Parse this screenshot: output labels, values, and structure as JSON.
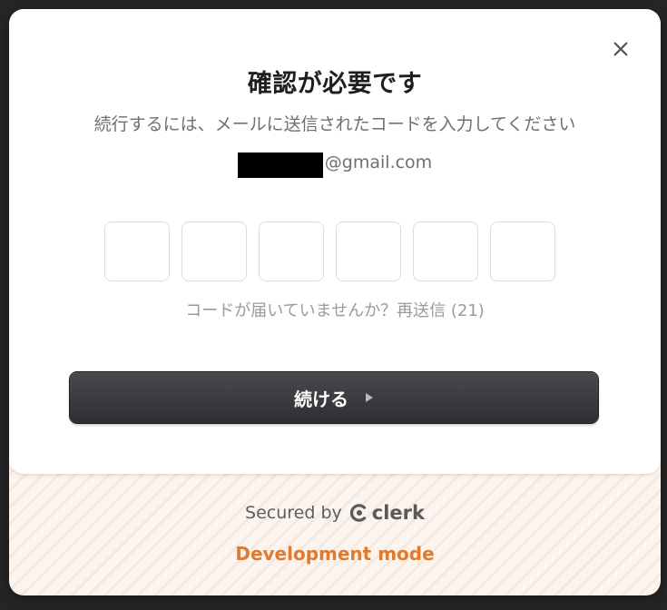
{
  "modal": {
    "title": "確認が必要です",
    "subtitle": "続行するには、メールに送信されたコードを入力してください",
    "email_domain": "@gmail.com",
    "code_boxes": [
      "",
      "",
      "",
      "",
      "",
      ""
    ],
    "resend_text": "コードが届いていませんか？再送信 (21)",
    "continue_label": "続ける",
    "close_icon": "close-icon",
    "continue_icon": "play-arrow-icon"
  },
  "footer": {
    "secured_by": "Secured by",
    "brand": "clerk",
    "dev_mode": "Development mode",
    "dev_mode_color": "#e07a2f"
  },
  "colors": {
    "button_bg": "#3a3a3e",
    "accent_orange": "#e07a2f"
  }
}
